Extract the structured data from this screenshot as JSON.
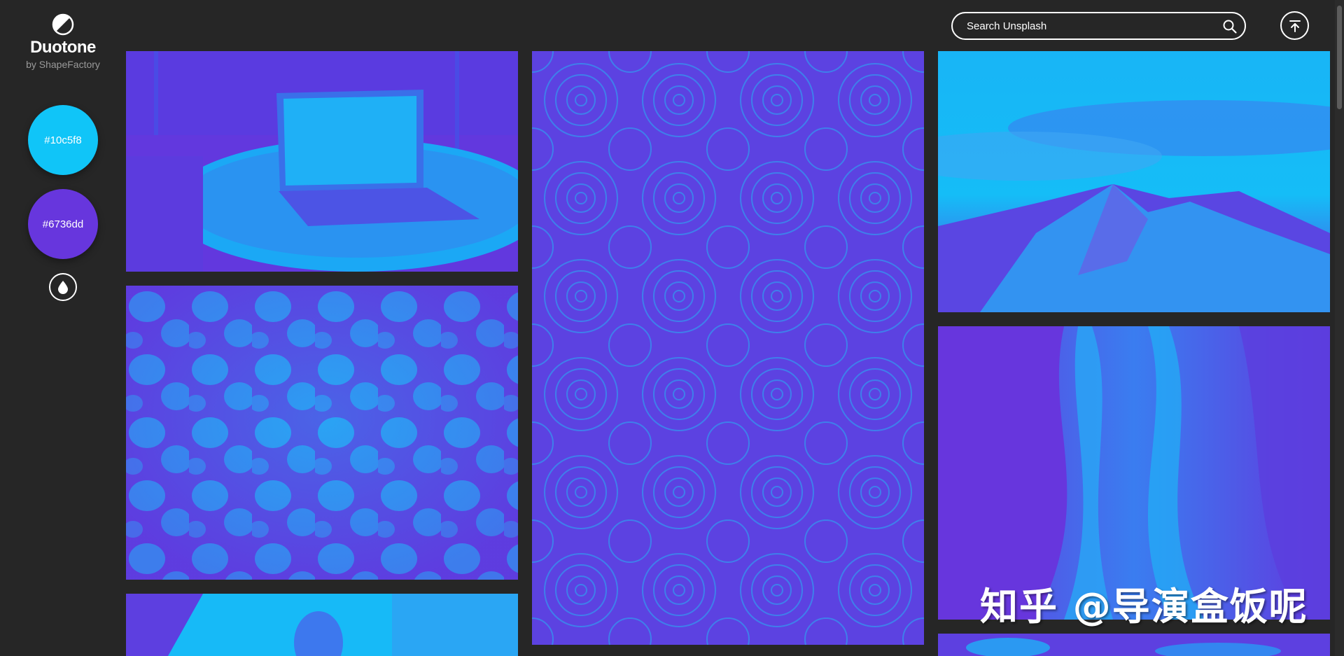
{
  "app": {
    "title": "Duotone",
    "subtitle": "by ShapeFactory"
  },
  "colors": {
    "light": "#10c5f8",
    "dark": "#6736dd",
    "background": "#262626"
  },
  "swatches": [
    {
      "label": "#10c5f8",
      "color": "#10c5f8"
    },
    {
      "label": "#6736dd",
      "color": "#6736dd"
    }
  ],
  "search": {
    "placeholder": "Search Unsplash",
    "icon": "search-icon"
  },
  "toolbar": {
    "drop_icon": "water-drop-icon",
    "top_icon": "scroll-to-top-icon"
  },
  "photos": [
    {
      "subject": "laptop on round table"
    },
    {
      "subject": "tulip bouquet"
    },
    {
      "subject": "woman portrait"
    },
    {
      "subject": "succulent rosettes"
    },
    {
      "subject": "snowy mountain under clouds"
    },
    {
      "subject": "sandstone canyon waves"
    },
    {
      "subject": "partial image"
    }
  ],
  "watermark": "知乎 @导演盒饭呢"
}
